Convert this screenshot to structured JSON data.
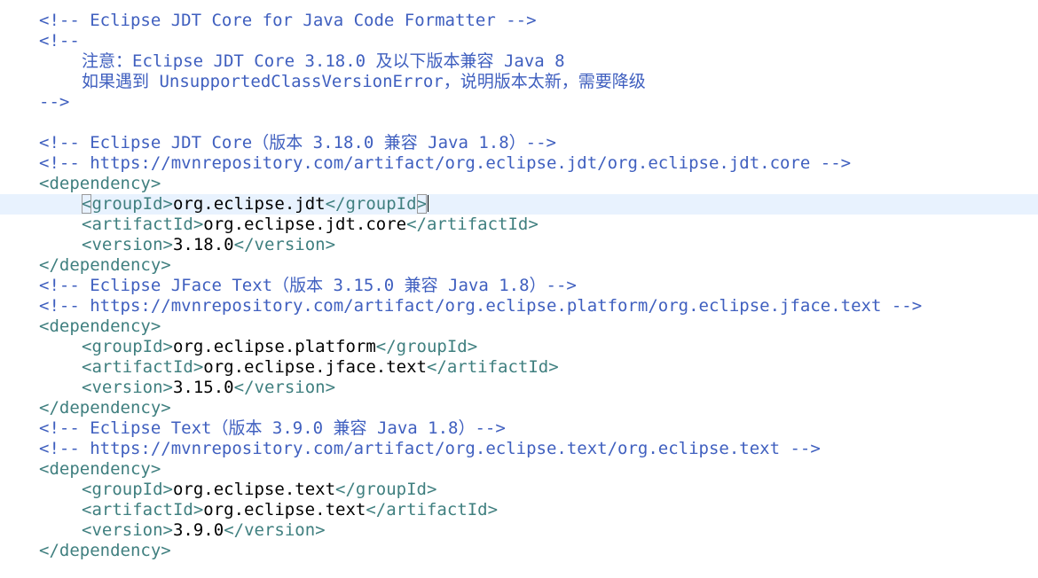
{
  "editor": {
    "lines": [
      {
        "k": "c",
        "text": "<!-- Eclipse JDT Core for Java Code Formatter -->"
      },
      {
        "k": "c",
        "text": "<!--"
      },
      {
        "k": "ci",
        "text": "注意：Eclipse JDT Core 3.18.0 及以下版本兼容 Java 8"
      },
      {
        "k": "ci",
        "text": "如果遇到 UnsupportedClassVersionError，说明版本太新，需要降级"
      },
      {
        "k": "c",
        "text": "-->"
      },
      {
        "k": "blank",
        "text": ""
      },
      {
        "k": "c",
        "text": "<!-- Eclipse JDT Core（版本 3.18.0 兼容 Java 1.8）-->"
      },
      {
        "k": "c",
        "text": "<!-- https://mvnrepository.com/artifact/org.eclipse.jdt/org.eclipse.jdt.core -->"
      },
      {
        "k": "tag",
        "text": "<dependency>"
      },
      {
        "k": "el",
        "open": "groupId",
        "value": "org.eclipse.jdt",
        "close": "groupId",
        "current": true
      },
      {
        "k": "el",
        "open": "artifactId",
        "value": "org.eclipse.jdt.core",
        "close": "artifactId"
      },
      {
        "k": "el",
        "open": "version",
        "value": "3.18.0",
        "close": "version"
      },
      {
        "k": "tag",
        "text": "</dependency>"
      },
      {
        "k": "c",
        "text": "<!-- Eclipse JFace Text（版本 3.15.0 兼容 Java 1.8）-->"
      },
      {
        "k": "c",
        "text": "<!-- https://mvnrepository.com/artifact/org.eclipse.platform/org.eclipse.jface.text -->"
      },
      {
        "k": "tag",
        "text": "<dependency>"
      },
      {
        "k": "el",
        "open": "groupId",
        "value": "org.eclipse.platform",
        "close": "groupId"
      },
      {
        "k": "el",
        "open": "artifactId",
        "value": "org.eclipse.jface.text",
        "close": "artifactId"
      },
      {
        "k": "el",
        "open": "version",
        "value": "3.15.0",
        "close": "version"
      },
      {
        "k": "tag",
        "text": "</dependency>"
      },
      {
        "k": "c",
        "text": "<!-- Eclipse Text（版本 3.9.0 兼容 Java 1.8）-->"
      },
      {
        "k": "c",
        "text": "<!-- https://mvnrepository.com/artifact/org.eclipse.text/org.eclipse.text -->"
      },
      {
        "k": "tag",
        "text": "<dependency>"
      },
      {
        "k": "el",
        "open": "groupId",
        "value": "org.eclipse.text",
        "close": "groupId"
      },
      {
        "k": "el",
        "open": "artifactId",
        "value": "org.eclipse.text",
        "close": "artifactId"
      },
      {
        "k": "el",
        "open": "version",
        "value": "3.9.0",
        "close": "version"
      },
      {
        "k": "tag",
        "text": "</dependency>"
      }
    ]
  },
  "colors": {
    "comment": "#3f5fbf",
    "tag": "#3f7f7f",
    "text": "#000000",
    "current_line": "#e8f2fe"
  }
}
